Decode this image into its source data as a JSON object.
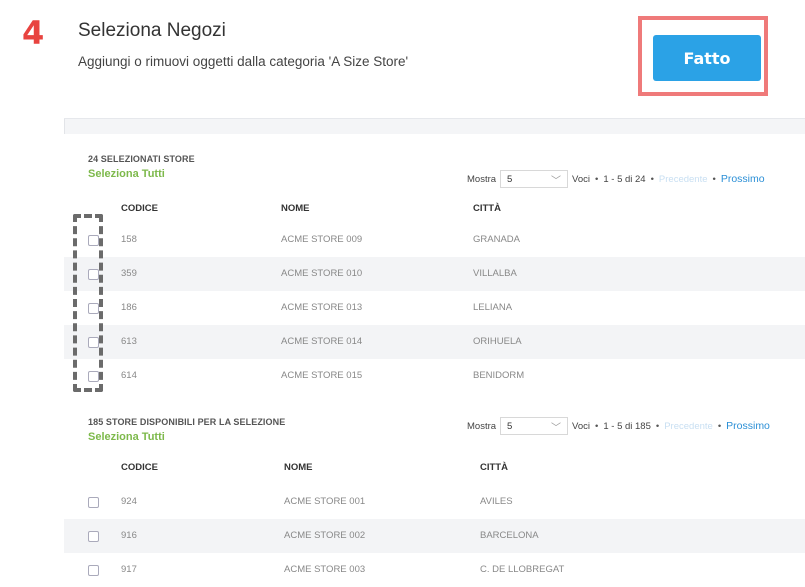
{
  "step_number": "4",
  "header": {
    "title": "Seleziona Negozi",
    "subtitle": "Aggiungi o rimuovi oggetti dalla categoria 'A Size Store'",
    "done_label": "Fatto"
  },
  "selected": {
    "title": "24 SELEZIONATI STORE",
    "select_all": "Seleziona Tutti",
    "pager": {
      "show_label": "Mostra",
      "page_size": "5",
      "entries_label": "Voci",
      "range": "1 - 5 di 24",
      "prev": "Precedente",
      "next": "Prossimo"
    },
    "columns": [
      "CODICE",
      "NOME",
      "CITTÀ"
    ],
    "rows": [
      {
        "code": "158",
        "name": "ACME STORE 009",
        "city": "GRANADA"
      },
      {
        "code": "359",
        "name": "ACME STORE 010",
        "city": "VILLALBA"
      },
      {
        "code": "186",
        "name": "ACME STORE 013",
        "city": "LELIANA"
      },
      {
        "code": "613",
        "name": "ACME STORE 014",
        "city": "ORIHUELA"
      },
      {
        "code": "614",
        "name": "ACME STORE 015",
        "city": "BENIDORM"
      }
    ]
  },
  "available": {
    "title": "185 STORE DISPONIBILI PER LA SELEZIONE",
    "select_all": "Seleziona Tutti",
    "pager": {
      "show_label": "Mostra",
      "page_size": "5",
      "entries_label": "Voci",
      "range": "1 - 5 di 185",
      "prev": "Precedente",
      "next": "Prossimo"
    },
    "columns": [
      "CODICE",
      "NOME",
      "CITTÀ"
    ],
    "rows": [
      {
        "code": "924",
        "name": "ACME STORE 001",
        "city": "AVILES"
      },
      {
        "code": "916",
        "name": "ACME STORE 002",
        "city": "BARCELONA"
      },
      {
        "code": "917",
        "name": "ACME STORE 003",
        "city": "C. DE LLOBREGAT"
      }
    ]
  },
  "colors": {
    "accent": "#2ba2e6",
    "select_all": "#7db94b",
    "step_number": "#e8433f",
    "highlight": "#ef7a7a"
  }
}
